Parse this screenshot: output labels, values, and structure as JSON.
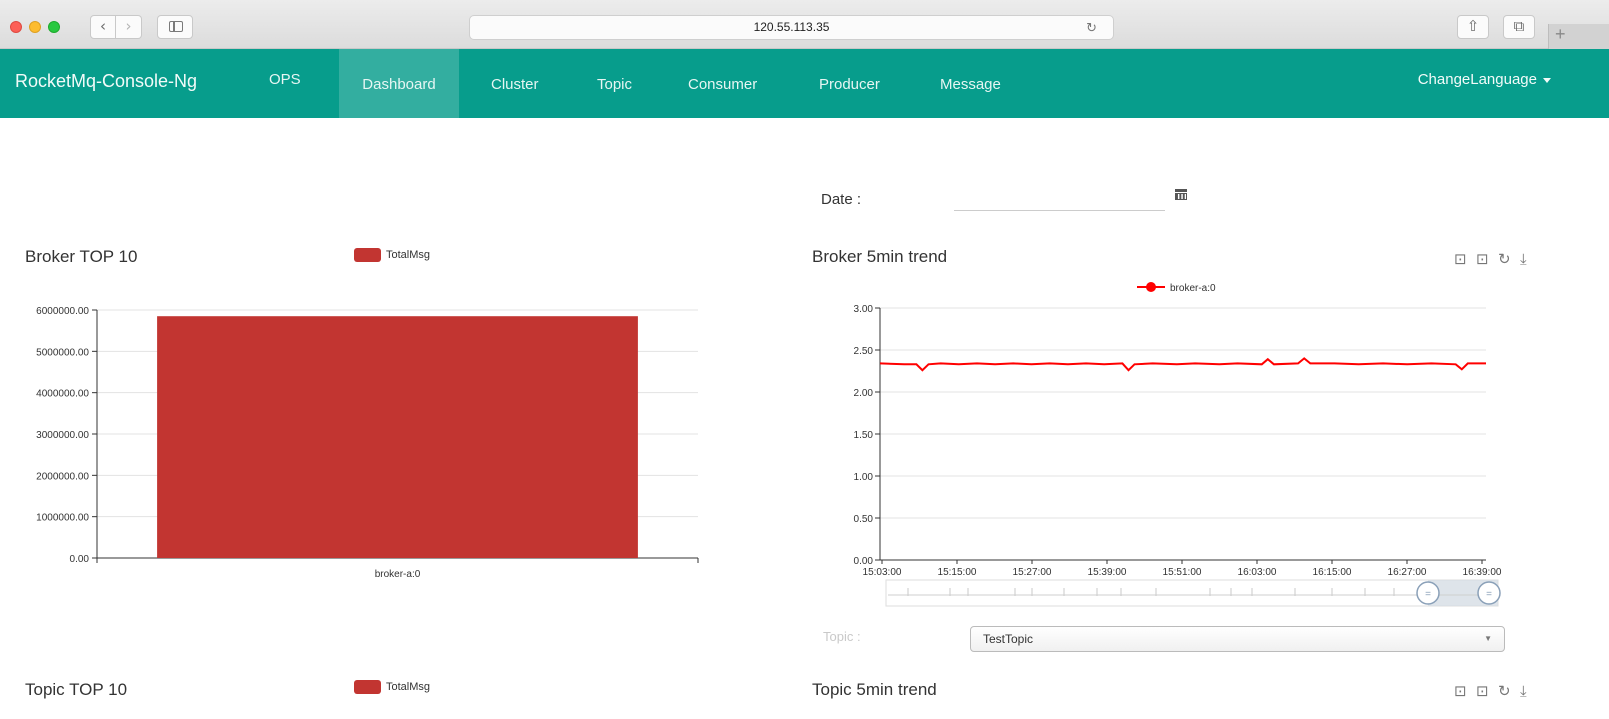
{
  "browser": {
    "url": "120.55.113.35",
    "back_glyph": "‹",
    "forward_glyph": "›",
    "reload_glyph": "↻",
    "share_glyph": "⇧",
    "tabs_glyph": "⧉",
    "new_tab_glyph": "+"
  },
  "navbar": {
    "brand": "RocketMq-Console-Ng",
    "items": [
      {
        "label": "OPS"
      },
      {
        "label": "Dashboard",
        "active": true
      },
      {
        "label": "Cluster"
      },
      {
        "label": "Topic"
      },
      {
        "label": "Consumer"
      },
      {
        "label": "Producer"
      },
      {
        "label": "Message"
      }
    ],
    "language": "ChangeLanguage",
    "color": "#079d8c"
  },
  "date_picker": {
    "label": "Date :",
    "value": ""
  },
  "broker_top10": {
    "title": "Broker TOP 10",
    "legend": "TotalMsg"
  },
  "broker_trend": {
    "title": "Broker 5min trend",
    "legend": "broker-a:0"
  },
  "topic_select": {
    "label": "Topic :",
    "value": "TestTopic"
  },
  "topic_top10": {
    "title": "Topic TOP 10",
    "legend": "TotalMsg"
  },
  "topic_trend": {
    "title": "Topic 5min trend"
  },
  "toolbox_glyphs": [
    "⊡",
    "⊡",
    "↻",
    "⤓"
  ],
  "chart_data": [
    {
      "type": "bar",
      "title": "Broker TOP 10",
      "categories": [
        "broker-a:0"
      ],
      "series": [
        {
          "name": "TotalMsg",
          "values": [
            5850000
          ],
          "color": "#c23531"
        }
      ],
      "y_ticks": [
        "0.00",
        "1000000.00",
        "2000000.00",
        "3000000.00",
        "4000000.00",
        "5000000.00",
        "6000000.00"
      ],
      "ylim": [
        0,
        6000000
      ],
      "grid": true,
      "legend_position": "top-center"
    },
    {
      "type": "line",
      "title": "Broker 5min trend",
      "x_ticks": [
        "15:03:00",
        "15:15:00",
        "15:27:00",
        "15:39:00",
        "15:51:00",
        "16:03:00",
        "16:15:00",
        "16:27:00",
        "16:39:00"
      ],
      "y_ticks": [
        "0.00",
        "0.50",
        "1.00",
        "1.50",
        "2.00",
        "2.50",
        "3.00"
      ],
      "ylim": [
        0,
        3
      ],
      "x_range_minutes": [
        0,
        100
      ],
      "series": [
        {
          "name": "broker-a:0",
          "color": "#ff0000",
          "points": [
            [
              0,
              2.34
            ],
            [
              4,
              2.33
            ],
            [
              6,
              2.33
            ],
            [
              7,
              2.26
            ],
            [
              8,
              2.33
            ],
            [
              10,
              2.34
            ],
            [
              13,
              2.33
            ],
            [
              16,
              2.34
            ],
            [
              19,
              2.33
            ],
            [
              22,
              2.34
            ],
            [
              25,
              2.33
            ],
            [
              28,
              2.34
            ],
            [
              31,
              2.33
            ],
            [
              34,
              2.34
            ],
            [
              37,
              2.33
            ],
            [
              40,
              2.34
            ],
            [
              41,
              2.26
            ],
            [
              42,
              2.33
            ],
            [
              45,
              2.34
            ],
            [
              49,
              2.33
            ],
            [
              52,
              2.34
            ],
            [
              56,
              2.33
            ],
            [
              59,
              2.34
            ],
            [
              63,
              2.33
            ],
            [
              64,
              2.39
            ],
            [
              65,
              2.33
            ],
            [
              69,
              2.34
            ],
            [
              70,
              2.4
            ],
            [
              71,
              2.34
            ],
            [
              75,
              2.34
            ],
            [
              79,
              2.33
            ],
            [
              83,
              2.34
            ],
            [
              87,
              2.33
            ],
            [
              91,
              2.34
            ],
            [
              95,
              2.33
            ],
            [
              96,
              2.27
            ],
            [
              97,
              2.34
            ],
            [
              100,
              2.34
            ]
          ]
        }
      ],
      "grid": true,
      "legend_position": "top-center"
    }
  ]
}
